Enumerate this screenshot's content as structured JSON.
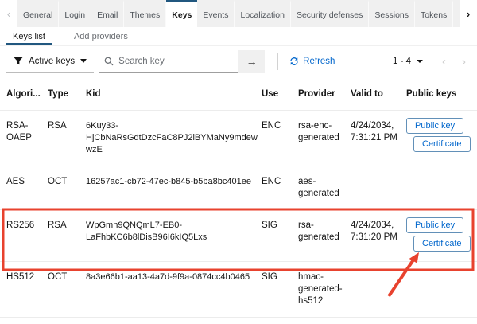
{
  "header_tabs": {
    "items": [
      "General",
      "Login",
      "Email",
      "Themes",
      "Keys",
      "Events",
      "Localization",
      "Security defenses",
      "Sessions",
      "Tokens"
    ],
    "active": "Keys"
  },
  "subtabs": {
    "items": [
      "Keys list",
      "Add providers"
    ],
    "active": "Keys list"
  },
  "toolbar": {
    "filter_value": "Active keys",
    "search_placeholder": "Search key",
    "refresh_label": "Refresh",
    "pagination_range": "1 - 4"
  },
  "icons": {
    "chevron_left": "‹",
    "chevron_right": "›",
    "arrow_right": "→"
  },
  "table": {
    "columns": [
      "Algori...",
      "Type",
      "Kid",
      "Use",
      "Provider",
      "Valid to",
      "Public keys"
    ],
    "rows": [
      {
        "algorithm": "RSA-OAEP",
        "type": "RSA",
        "kid": "6Kuy33-HjCbNaRsGdtDzcFaC8PJ2lBYMaNy9mdewwzE",
        "use": "ENC",
        "provider": "rsa-enc-generated",
        "valid_to": "4/24/2034, 7:31:21 PM",
        "actions": [
          "Public key",
          "Certificate"
        ]
      },
      {
        "algorithm": "AES",
        "type": "OCT",
        "kid": "16257ac1-cb72-47ec-b845-b5ba8bc401ee",
        "use": "ENC",
        "provider": "aes-generated",
        "valid_to": ""
      },
      {
        "algorithm": "RS256",
        "type": "RSA",
        "kid": "WpGmn9QNQmL7-EB0-LaFhbKC6b8lDisB96I6kIQ5Lxs",
        "use": "SIG",
        "provider": "rsa-generated",
        "valid_to": "4/24/2034, 7:31:20 PM",
        "actions": [
          "Public key",
          "Certificate"
        ],
        "highlighted": true
      },
      {
        "algorithm": "HS512",
        "type": "OCT",
        "kid": "8a3e66b1-aa13-4a7d-9f9a-0874cc4b0465",
        "use": "SIG",
        "provider": "hmac-generated-hs512",
        "valid_to": ""
      }
    ]
  },
  "colors": {
    "tab_indicator": "#21577f",
    "link_blue": "#0066cc",
    "annotation_red": "#e8422e"
  }
}
